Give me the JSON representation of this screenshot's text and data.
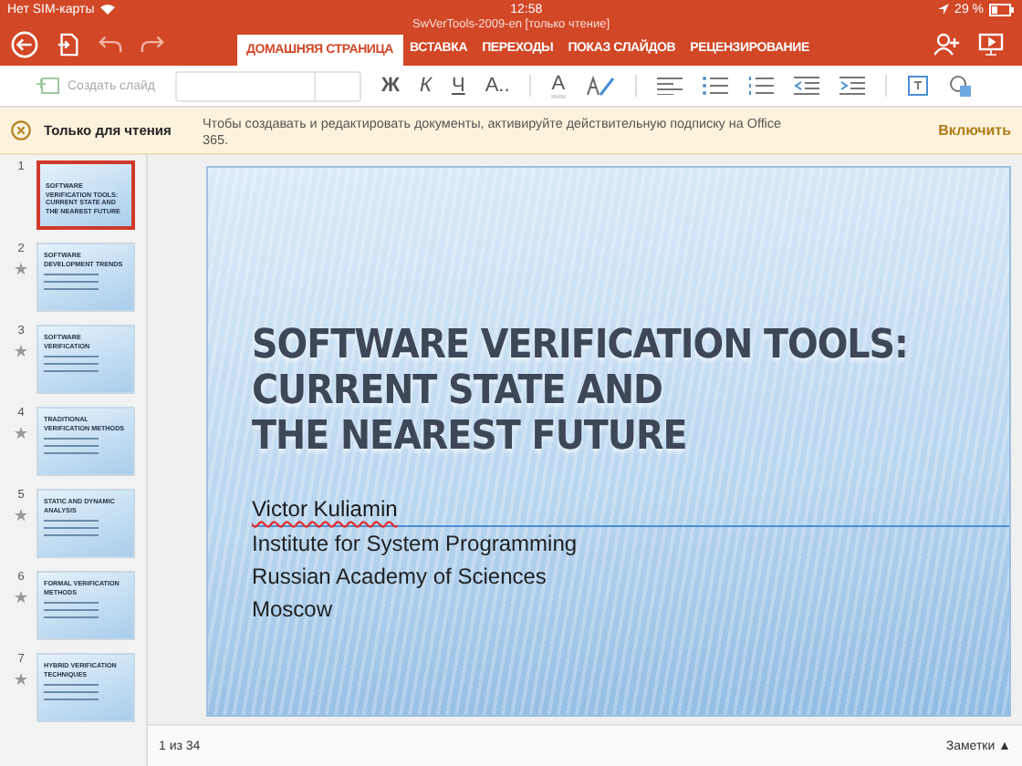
{
  "status_bar": {
    "carrier": "Нет SIM-карты",
    "time": "12:58",
    "battery": "29 %"
  },
  "window": {
    "title": "SwVerTools-2009-en [только чтение]"
  },
  "tabs": [
    {
      "label": "ДОМАШНЯЯ СТРАНИЦА",
      "selected": true
    },
    {
      "label": "ВСТАВКА",
      "selected": false
    },
    {
      "label": "ПЕРЕХОДЫ",
      "selected": false
    },
    {
      "label": "ПОКАЗ СЛАЙДОВ",
      "selected": false
    },
    {
      "label": "РЕЦЕНЗИРОВАНИЕ",
      "selected": false
    }
  ],
  "toolbar": {
    "new_slide": "Создать слайд",
    "bold": "Ж",
    "italic": "К",
    "underline": "Ч",
    "font_effects": "А..",
    "font_color": "А"
  },
  "banner": {
    "title": "Только для чтения",
    "message": "Чтобы создавать и редактировать документы, активируйте действительную подписку на Office 365.",
    "action": "Включить"
  },
  "slides": [
    {
      "number": "1",
      "title": "SOFTWARE VERIFICATION TOOLS: CURRENT STATE AND THE NEAREST FUTURE",
      "selected": true,
      "starred": false
    },
    {
      "number": "2",
      "title": "SOFTWARE DEVELOPMENT TRENDS",
      "selected": false,
      "starred": true
    },
    {
      "number": "3",
      "title": "SOFTWARE VERIFICATION",
      "selected": false,
      "starred": true
    },
    {
      "number": "4",
      "title": "TRADITIONAL VERIFICATION METHODS",
      "selected": false,
      "starred": true
    },
    {
      "number": "5",
      "title": "STATIC AND DYNAMIC ANALYSIS",
      "selected": false,
      "starred": true
    },
    {
      "number": "6",
      "title": "FORMAL VERIFICATION METHODS",
      "selected": false,
      "starred": true
    },
    {
      "number": "7",
      "title": "HYBRID VERIFICATION TECHNIQUES",
      "selected": false,
      "starred": true
    }
  ],
  "slide": {
    "title_lines": [
      "SOFTWARE VERIFICATION TOOLS:",
      "CURRENT STATE AND",
      "THE NEAREST FUTURE"
    ],
    "author": "Victor Kuliamin",
    "lines": [
      "Institute for System Programming",
      "Russian Academy of Sciences",
      "Moscow"
    ]
  },
  "footer": {
    "page": "1 из 34",
    "notes": "Заметки",
    "notes_arrow": "▲"
  }
}
